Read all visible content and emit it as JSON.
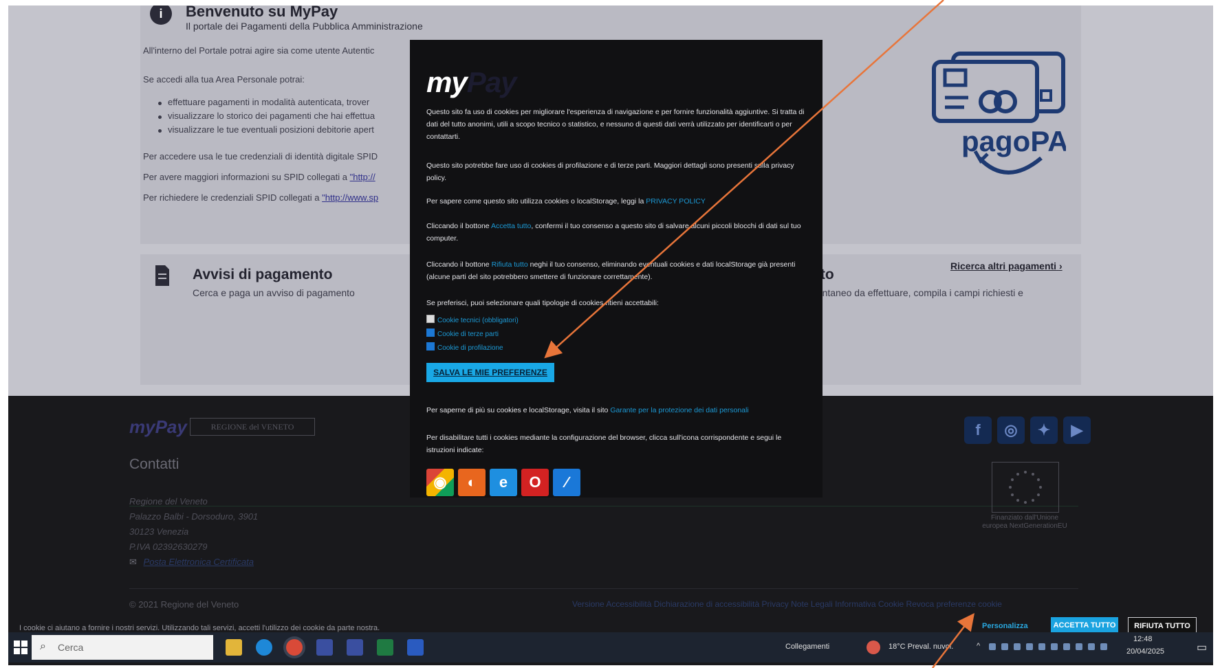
{
  "page": {
    "welcome_title": "Benvenuto su MyPay",
    "welcome_subtitle": "Il portale dei Pagamenti della Pubblica Amministrazione",
    "intro": "All'interno del Portale potrai agire sia come utente Autentic",
    "area_personale": "Se accedi alla tua Area Personale potrai:",
    "bullets": [
      "effettuare pagamenti in modalità autenticata, trover",
      "visualizzare lo storico dei pagamenti che hai effettua",
      "visualizzare le tue eventuali posizioni debitorie apert"
    ],
    "spid_line_1": "Per accedere usa le tue credenziali di identità digitale SPID",
    "spid_line_2_prefix": "Per avere maggiori informazioni su SPID collegati a ",
    "spid_line_2_link": "\"http://",
    "spid_line_3_prefix": "Per richiedere le credenziali SPID collegati a ",
    "spid_line_3_link": "\"http://www.sp",
    "pagopa_logo_text": "pagoPA",
    "avvisi_title": "Avvisi di pagamento",
    "avvisi_subtitle": "Cerca e paga un avviso di pagamento",
    "spontaneo_title": "nto",
    "spontaneo_subtitle": "pontaneo da effettuare, compila i campi richiesti e",
    "ricerca_link": "Ricerca altri pagamenti",
    "ricerca_chevron": "›"
  },
  "modal": {
    "logo_my": "my",
    "logo_pay": "Pay",
    "p1": "Questo sito fa uso di cookies per migliorare l'esperienza di navigazione e per fornire funzionalità aggiuntive. Si tratta di dati del tutto anonimi, utili a scopo tecnico o statistico, e nessuno di questi dati verrà utilizzato per identificarti o per contattarti.",
    "p2": "Questo sito potrebbe fare uso di cookies di profilazione e di terze parti. Maggiori dettagli sono presenti sulla privacy policy.",
    "p3_prefix": "Per sapere come questo sito utilizza cookies o localStorage, leggi la ",
    "p3_link": "PRIVACY POLICY",
    "p4_prefix": "Cliccando il bottone ",
    "p4_link": "Accetta tutto",
    "p4_suffix": ", confermi il tuo consenso a questo sito di salvare alcuni piccoli blocchi di dati sul tuo computer.",
    "p5_prefix": "Cliccando il bottone ",
    "p5_link": "Rifiuta tutto",
    "p5_suffix": " neghi il tuo consenso, eliminando eventuali cookies e dati localStorage già presenti (alcune parti del sito potrebbero smettere di funzionare correttamente).",
    "p6": "Se preferisci, puoi selezionare quali tipologie di cookies ritieni accettabili:",
    "checkboxes": [
      {
        "label": "Cookie tecnici (obbligatori)",
        "checked": false
      },
      {
        "label": "Cookie di terze parti",
        "checked": true
      },
      {
        "label": "Cookie di profilazione",
        "checked": true
      }
    ],
    "save_button": "SALVA LE MIE PREFERENZE",
    "p7_prefix": "Per saperne di più su cookies e localStorage, visita il sito ",
    "p7_link": "Garante per la protezione dei dati personali",
    "p8": "Per disabilitare tutti i cookies mediante la configurazione del browser, clicca sull'icona corrispondente e segui le istruzioni indicate:",
    "browsers": [
      "chrome",
      "firefox",
      "internet-explorer",
      "opera",
      "edge"
    ]
  },
  "footer": {
    "mypay_logo": "myPay",
    "regione_logo": "REGIONE del VENETO",
    "contatti": "Contatti",
    "address": [
      "Regione del Veneto",
      "Palazzo Balbi - Dorsoduro, 3901",
      "30123 Venezia",
      "P.IVA 02392630279"
    ],
    "pec_link": "Posta Elettronica Certificata",
    "copyright": "© 2021 Regione del Veneto",
    "links": "Versione  Accessibilità  Dichiarazione di accessibilità  Privacy  Note Legali  Informativa Cookie  Revoca preferenze cookie",
    "eu_text": "Finanziato dall'Unione europea NextGenerationEU",
    "social": [
      "facebook",
      "instagram",
      "twitter",
      "youtube"
    ]
  },
  "cookie_banner": {
    "text": "I cookie ci aiutano a fornire i nostri servizi. Utilizzando tali servizi, accetti l'utilizzo dei cookie da parte nostra.",
    "personalizza": "Personalizza",
    "accetta": "ACCETTA TUTTO",
    "rifiuta": "RIFIUTA TUTTO"
  },
  "taskbar": {
    "search_placeholder": "Cerca",
    "collegamenti": "Collegamenti",
    "weather": "18°C  Preval. nuvol.",
    "time": "12:48",
    "date": "20/04/2025"
  },
  "colors": {
    "accent_blue": "#19a8e6",
    "arrow_orange": "#e8753a",
    "footer_bg": "#19191c",
    "modal_bg": "#111113"
  }
}
